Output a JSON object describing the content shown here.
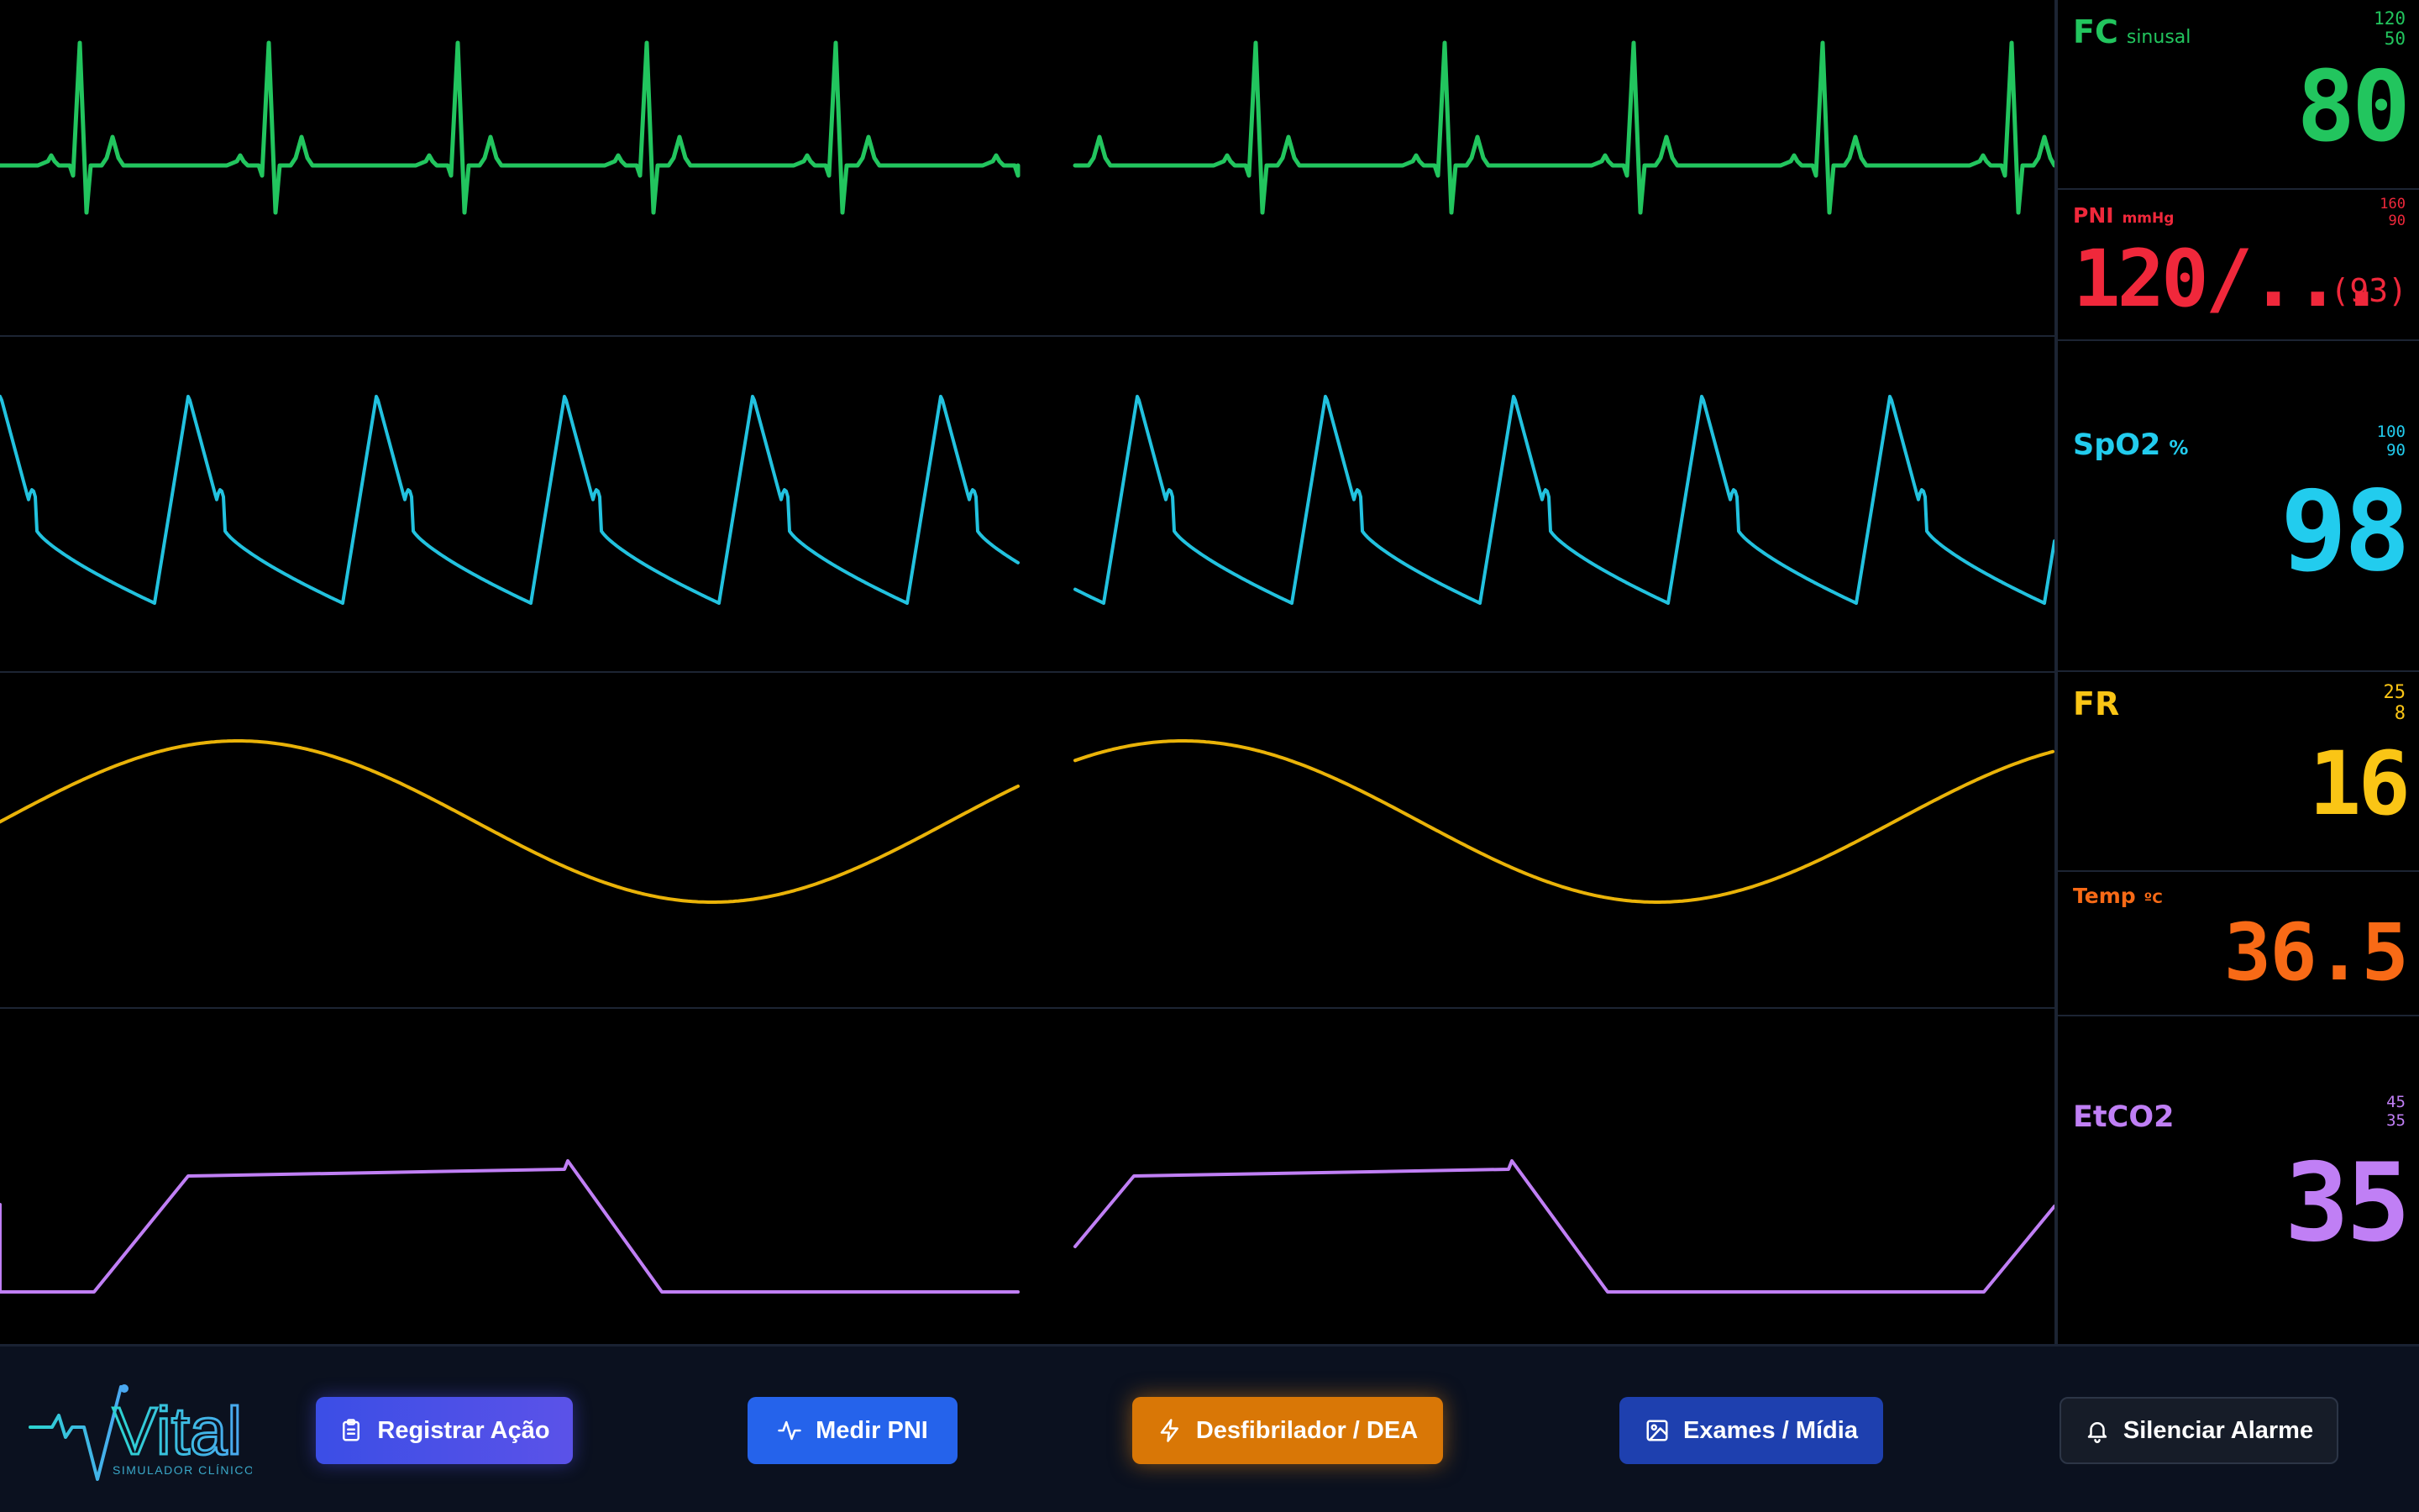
{
  "vitals": {
    "fc": {
      "label": "FC",
      "unit": "sinusal",
      "high": "120",
      "low": "50",
      "value": "80",
      "color": "#22c55e"
    },
    "pni": {
      "label": "PNI",
      "unit": "mmHg",
      "high": "160",
      "low": "90",
      "value": "120/...",
      "mean": "(93)",
      "color": "#f0283b"
    },
    "spo2": {
      "label": "SpO2",
      "unit": "%",
      "high": "100",
      "low": "90",
      "value": "98",
      "color": "#22ccee"
    },
    "fr": {
      "label": "FR",
      "unit": "",
      "high": "25",
      "low": "8",
      "value": "16",
      "color": "#fac515"
    },
    "temp": {
      "label": "Temp",
      "unit": "ºC",
      "value": "36.5",
      "color": "#f86a16"
    },
    "etco2": {
      "label": "EtCO2",
      "unit": "",
      "high": "45",
      "low": "35",
      "value": "35",
      "color": "#c07ff5"
    }
  },
  "footer": {
    "logo_text": "Vital",
    "logo_subtitle": "SIMULADOR CLÍNICO",
    "buttons": {
      "registrar": "Registrar Ação",
      "medir_pni": "Medir PNI",
      "desfibrilador": "Desfibrilador / DEA",
      "exames": "Exames / Mídia",
      "silenciar": "Silenciar Alarme"
    }
  },
  "colors": {
    "ecg": "#22c55e",
    "pleth": "#22c2df",
    "resp": "#eab308",
    "capno": "#c07ff5",
    "divider": "#1c2433",
    "footer_bg": "#0b111f"
  }
}
